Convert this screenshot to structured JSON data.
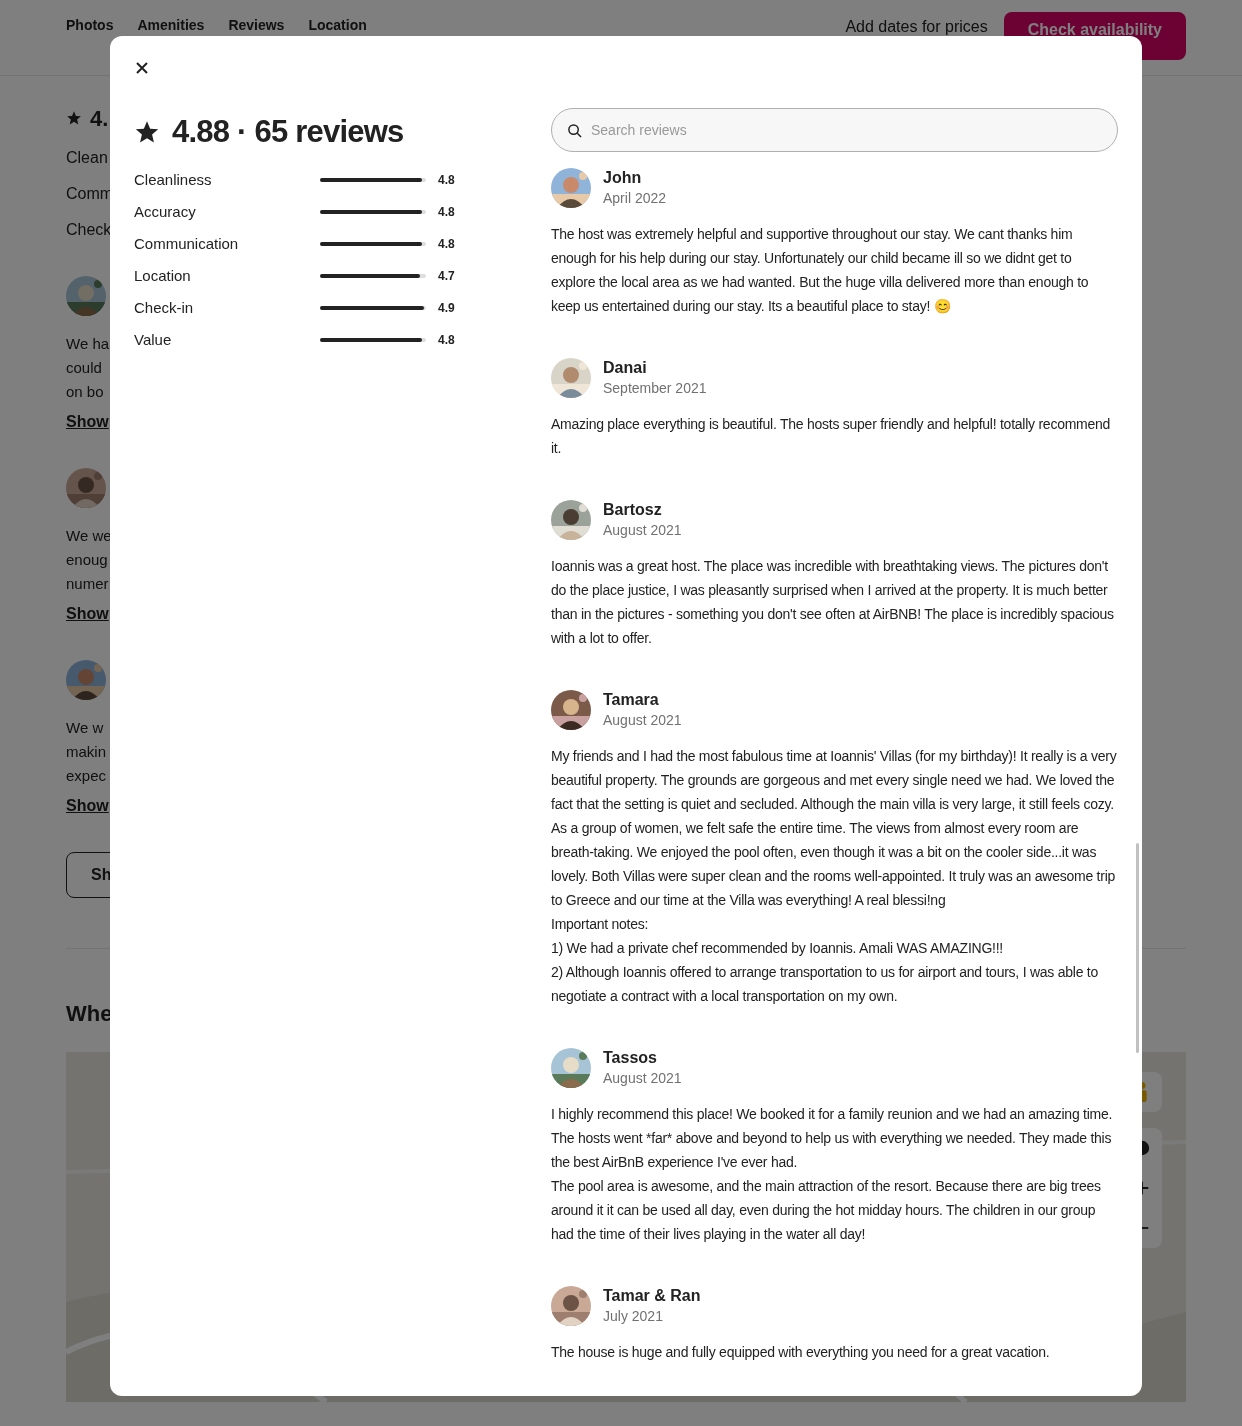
{
  "page": {
    "nav_tabs": [
      {
        "label": "Photos"
      },
      {
        "label": "Amenities"
      },
      {
        "label": "Reviews"
      },
      {
        "label": "Location"
      }
    ],
    "price_hint": "Add dates for prices",
    "availability_button": "Check availability",
    "rating_heading": "4.",
    "categories": [
      "Clean",
      "Comm",
      "Check"
    ],
    "reviews": [
      {
        "lines": [
          "We ha",
          "could",
          "on bo"
        ],
        "link": "Show"
      },
      {
        "lines": [
          "We we",
          "enoug",
          "numer"
        ],
        "link": "Show"
      },
      {
        "lines": [
          "We w",
          "makin",
          "expec"
        ],
        "link": "Show"
      }
    ],
    "show_all_button": "Sh",
    "section_heading": "Whe"
  },
  "modal": {
    "title": "4.88 · 65 reviews",
    "ratings": [
      {
        "label": "Cleanliness",
        "value": "4.8",
        "level": 0.96
      },
      {
        "label": "Accuracy",
        "value": "4.8",
        "level": 0.96
      },
      {
        "label": "Communication",
        "value": "4.8",
        "level": 0.96
      },
      {
        "label": "Location",
        "value": "4.7",
        "level": 0.94
      },
      {
        "label": "Check-in",
        "value": "4.9",
        "level": 0.98
      },
      {
        "label": "Value",
        "value": "4.8",
        "level": 0.96
      }
    ],
    "search": {
      "placeholder": "Search reviews"
    },
    "reviews": [
      {
        "name": "John",
        "date": "April 2022",
        "paragraphs": [
          "The host was extremely helpful and supportive throughout our stay. We cant thanks him enough for his help during our stay. Unfortunately our child became ill so we didnt get to explore the local area as we had wanted. But the huge villa delivered more than enough to keep us entertained during our stay. Its a beautiful place to stay! 😊"
        ]
      },
      {
        "name": "Danai",
        "date": "September 2021",
        "paragraphs": [
          "Amazing place everything is beautiful. The hosts super friendly and helpful! totally recommend it."
        ]
      },
      {
        "name": "Bartosz",
        "date": "August 2021",
        "paragraphs": [
          "Ioannis was a great host. The place was incredible with breathtaking views. The pictures don't do the place justice, I was pleasantly surprised when I arrived at the property. It is much better than in the pictures - something you don't see often at AirBNB! The place is incredibly spacious with a lot to offer."
        ]
      },
      {
        "name": "Tamara",
        "date": "August 2021",
        "paragraphs": [
          "My friends and I had the most fabulous time at Ioannis' Villas (for my birthday)! It really is a very beautiful property. The grounds are gorgeous and met every single need we had. We loved the fact that the setting is quiet and secluded. Although the main villa is very large, it still feels cozy. As a group of women, we felt safe the entire time. The views from almost every room are breath-taking. We enjoyed the pool often, even though it was a bit on the cooler side...it was lovely. Both Villas were super clean and the rooms well-appointed. It truly was an awesome trip to Greece and our time at the Villa was everything! A real blessi!ng",
          "Important notes:",
          "1) We had a private chef recommended by Ioannis. Amali WAS AMAZING!!!",
          "2) Although Ioannis offered to arrange transportation to us for airport and tours, I was able to negotiate a contract with a local transportation on my own."
        ]
      },
      {
        "name": "Tassos",
        "date": "August 2021",
        "paragraphs": [
          "I highly recommend this place! We booked it for a family reunion and we had an amazing time. The hosts went *far* above and beyond to help us with everything we needed. They made this the best AirBnB experience I've ever had.",
          "The pool area is awesome, and the main attraction of the resort. Because there are big trees around it it can be used all day, even during the hot midday hours. The children in our group had the time of their lives playing in the water all day!"
        ]
      },
      {
        "name": "Tamar & Ran",
        "date": "July 2021",
        "paragraphs": [
          "The house is huge and fully equipped with everything you need for a great vacation."
        ]
      }
    ]
  }
}
